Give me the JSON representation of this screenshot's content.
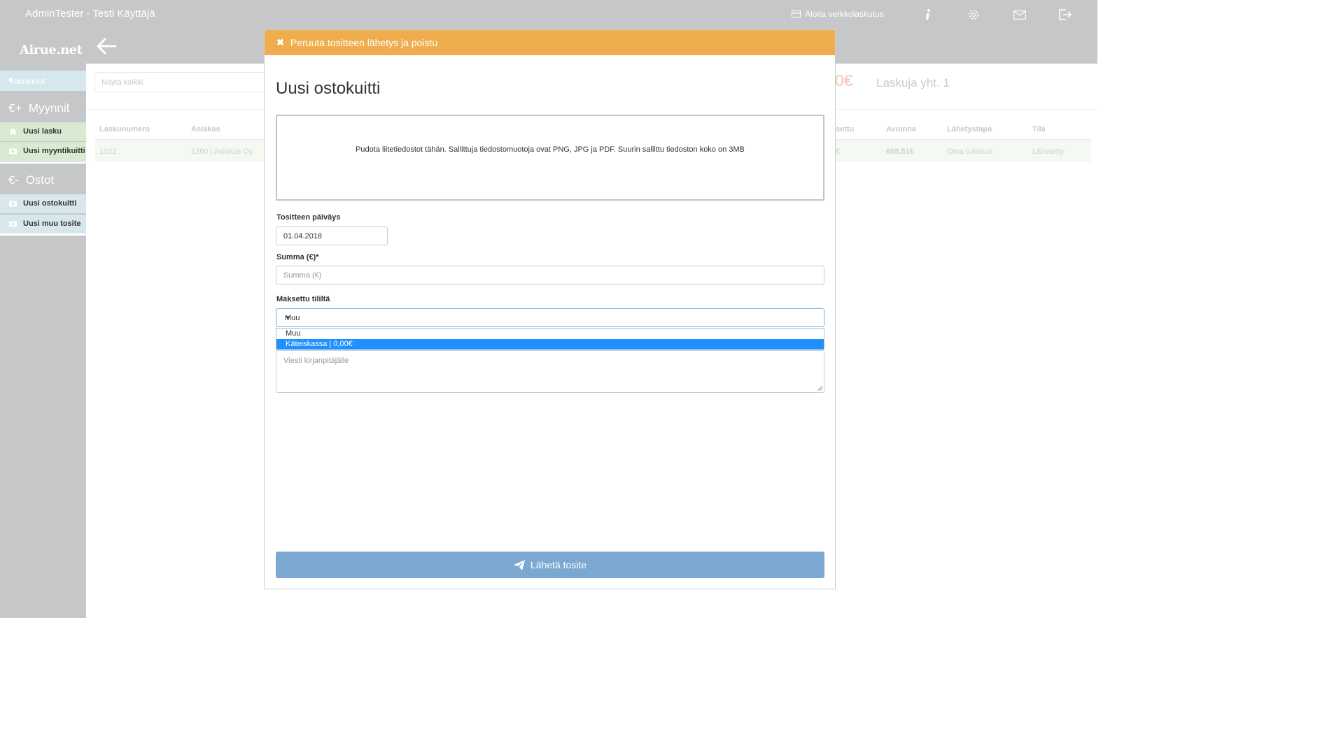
{
  "topbar": {
    "user": "AdminTester - Testi Käyttäjä",
    "einvoice_label": "Aloita verkkolaskutus",
    "icons": [
      "info-icon",
      "gear-icon",
      "mail-icon",
      "logout-icon"
    ]
  },
  "sidebar": {
    "logo": "Airue.net",
    "toiminnot": "Toiminnot",
    "sales_head": "Myynnit",
    "sales_prefix": "€+",
    "sales_items": [
      "Uusi lasku",
      "Uusi myyntikuitti"
    ],
    "purchases_head": "Ostot",
    "purchases_prefix": "€-",
    "purchase_items": [
      "Uusi ostokuitti",
      "Uusi muu tosite"
    ]
  },
  "list": {
    "search_placeholder": "Näytä kaikki",
    "total_amount": "0€",
    "total_count": "Laskuja yht. 1",
    "columns": [
      "Laskunumero",
      "Asiakas",
      "settu",
      "Avoinna",
      "Lähetystapa",
      "Tila"
    ],
    "row": {
      "number": "1022",
      "customer": "1360 | Asiakas Oy",
      "paid": "€",
      "open": "668,51€",
      "method": "Oma tulostus",
      "status": "Lähetetty"
    }
  },
  "modal": {
    "cancel_label": "Peruuta tositteen lähetys ja poistu",
    "title": "Uusi ostokuitti",
    "dropzone_text": "Pudota liitetiedostot tähän. Sallittuja tiedostomuotoja ovat PNG, JPG ja PDF. Suurin sallittu tiedoston koko on 3MB",
    "date_label": "Tositteen päiväys",
    "date_value": "01.04.2018",
    "sum_label": "Summa (€)*",
    "sum_placeholder": "Summa (€)",
    "account_label": "Maksettu tililtä",
    "account_value": "Muu",
    "account_options": [
      "Muu",
      "Käteiskassa | 0,00€"
    ],
    "message_placeholder": "Viesti kirjanpitäjälle",
    "submit_label": "Lähetä tosite"
  },
  "colors": {
    "topbar": "#c6c7c9",
    "warning_header": "#efad4d",
    "submit": "#7ba8d1",
    "option_selected": "#1e90ff"
  }
}
